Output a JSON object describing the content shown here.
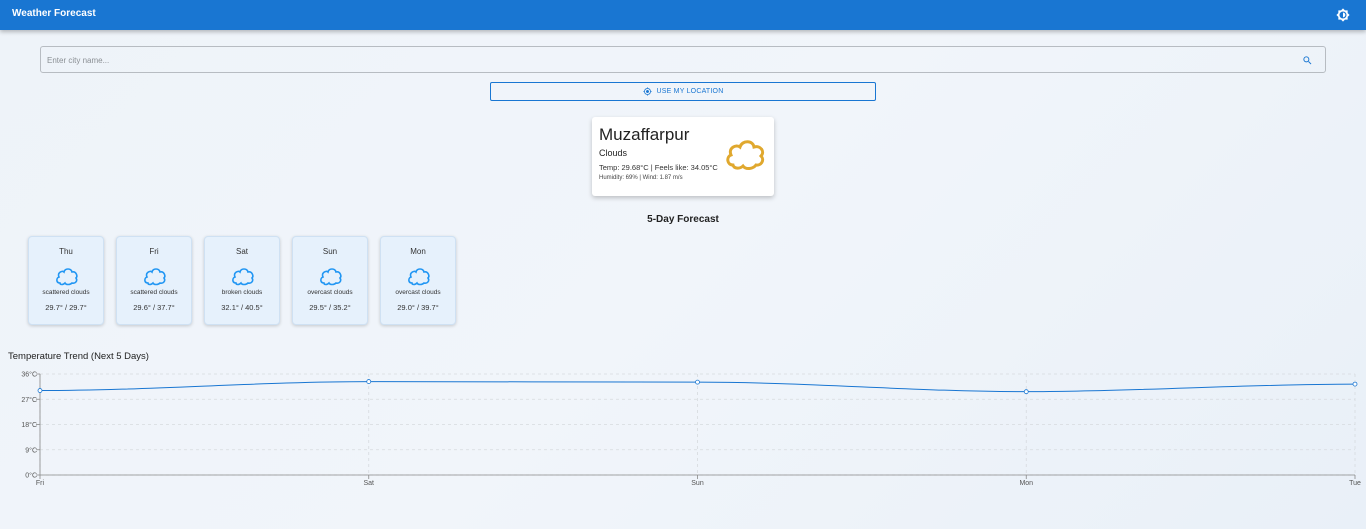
{
  "app": {
    "title": "Weather Forecast",
    "theme_icon": "brightness-icon"
  },
  "search": {
    "placeholder": "Enter city name...",
    "value": "",
    "button_icon": "search-icon"
  },
  "location_button": {
    "label": "USE MY LOCATION",
    "icon": "my-location-icon"
  },
  "current": {
    "city": "Muzaffarpur",
    "condition": "Clouds",
    "temp_line": "Temp: 29.68°C | Feels like: 34.05°C",
    "details_line": "Humidity: 69% | Wind: 1.87 m/s",
    "icon": "cloud-icon",
    "icon_color": "#e0a82e"
  },
  "forecast": {
    "title": "5-Day Forecast",
    "icon_color": "#2196f3",
    "days": [
      {
        "day": "Thu",
        "description": "scattered clouds",
        "temps": "29.7° / 29.7°",
        "icon": "cloud-icon"
      },
      {
        "day": "Fri",
        "description": "scattered clouds",
        "temps": "29.6° / 37.7°",
        "icon": "cloud-icon"
      },
      {
        "day": "Sat",
        "description": "broken clouds",
        "temps": "32.1° / 40.5°",
        "icon": "cloud-icon"
      },
      {
        "day": "Sun",
        "description": "overcast clouds",
        "temps": "29.5° / 35.2°",
        "icon": "cloud-icon"
      },
      {
        "day": "Mon",
        "description": "overcast clouds",
        "temps": "29.0° / 39.7°",
        "icon": "cloud-icon"
      }
    ]
  },
  "chart_data": {
    "type": "line",
    "title": "Temperature Trend (Next 5 Days)",
    "categories": [
      "Fri",
      "Sat",
      "Sun",
      "Mon",
      "Tue"
    ],
    "y_ticks": [
      "0°C",
      "9°C",
      "18°C",
      "27°C",
      "36°C"
    ],
    "ylim": [
      0,
      36
    ],
    "grid": true,
    "line_color": "#1976d2",
    "series": [
      {
        "values": [
          30.1,
          33.3,
          33.1,
          29.7,
          32.4
        ]
      }
    ]
  },
  "colors": {
    "primary": "#1976d2",
    "appbar_text": "#ffffff"
  }
}
